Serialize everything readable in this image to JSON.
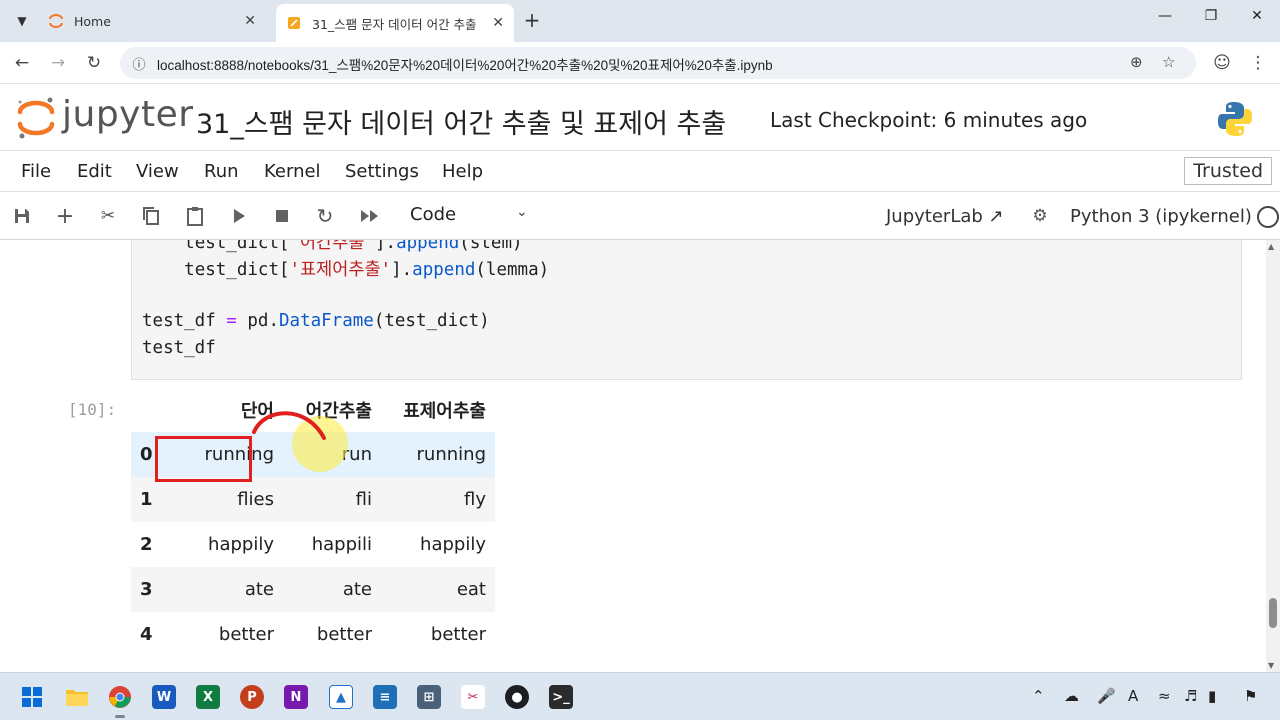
{
  "browser": {
    "tabs": [
      {
        "title": "Home",
        "active": false
      },
      {
        "title": "31_스팸 문자 데이터 어간 추출",
        "active": true
      }
    ],
    "address": "localhost:8888/notebooks/31_스팸%20문자%20데이터%20어간%20추출%20및%20표제어%20추출.ipynb"
  },
  "jupyter": {
    "logo_text": "jupyter",
    "notebook_title": "31_스팸 문자 데이터 어간 추출 및 표제어 추출",
    "checkpoint": "Last Checkpoint: 6 minutes ago",
    "menu": [
      "File",
      "Edit",
      "View",
      "Run",
      "Kernel",
      "Settings",
      "Help"
    ],
    "trusted": "Trusted",
    "cell_type": "Code",
    "jupyterlab_link": "JupyterLab",
    "kernel_name": "Python 3 (ipykernel)"
  },
  "code": {
    "line1": {
      "indent": "    ",
      "obj": "test_dict[",
      "key": "'어간추출'",
      "close": "].",
      "method": "append",
      "args": "(stem)"
    },
    "line2": {
      "indent": "    ",
      "obj": "test_dict[",
      "key": "'표제어추출'",
      "close": "].",
      "method": "append",
      "args": "(lemma)"
    },
    "line3": {
      "lhs": "test_df ",
      "eq": "=",
      "mid": " pd.",
      "cls": "DataFrame",
      "args": "(test_dict)"
    },
    "line4": "test_df"
  },
  "output": {
    "prompt": "[10]:",
    "columns": [
      "단어",
      "어간추출",
      "표제어추출"
    ],
    "rows": [
      {
        "index": "0",
        "cells": [
          "running",
          "run",
          "running"
        ]
      },
      {
        "index": "1",
        "cells": [
          "flies",
          "fli",
          "fly"
        ]
      },
      {
        "index": "2",
        "cells": [
          "happily",
          "happili",
          "happily"
        ]
      },
      {
        "index": "3",
        "cells": [
          "ate",
          "ate",
          "eat"
        ]
      },
      {
        "index": "4",
        "cells": [
          "better",
          "better",
          "better"
        ]
      }
    ]
  },
  "colors": {
    "annotation_red": "#e02020",
    "highlight_row": "#e3f2fd",
    "cursor_yellow": "#ffeb3b"
  },
  "taskbar": {
    "apps": [
      "windows-start",
      "file-explorer",
      "chrome",
      "word",
      "excel",
      "powerpoint",
      "onenote",
      "app-blue",
      "notepad",
      "calculator",
      "snipping-tool",
      "github",
      "terminal"
    ],
    "tray_icons": [
      "chevron-up",
      "cloud",
      "microphone",
      "language",
      "wifi",
      "volume",
      "battery",
      "notifications"
    ]
  }
}
